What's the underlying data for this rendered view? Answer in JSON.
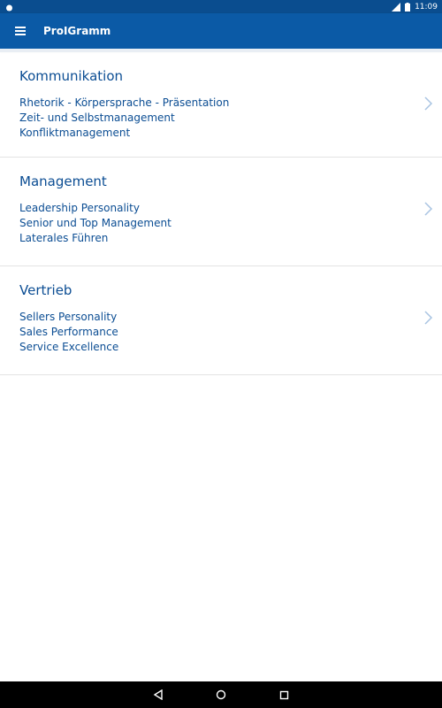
{
  "status_bar": {
    "time": "11:09",
    "icons": [
      "android-debug-icon",
      "signal-icon",
      "battery-icon"
    ]
  },
  "app_bar": {
    "title": "ProIGramm",
    "menu_icon": "menu-icon"
  },
  "categories": [
    {
      "title": "Kommunikation",
      "items": [
        "Rhetorik - Körpersprache - Präsentation",
        "Zeit- und Selbstmanagement",
        "Konfliktmanagement"
      ]
    },
    {
      "title": "Management",
      "items": [
        "Leadership Personality",
        "Senior und Top Management",
        "Laterales Führen"
      ]
    },
    {
      "title": "Vertrieb",
      "items": [
        "Sellers Personality",
        "Sales Performance",
        "Service Excellence"
      ]
    }
  ],
  "nav_bar": {
    "icons": [
      "back-icon",
      "home-icon",
      "recents-icon"
    ]
  },
  "colors": {
    "app_bar": "#0b5aa6",
    "status_bar": "#0a4d8f",
    "text_primary": "#0b4d93",
    "chevron": "#a9c4e2"
  }
}
